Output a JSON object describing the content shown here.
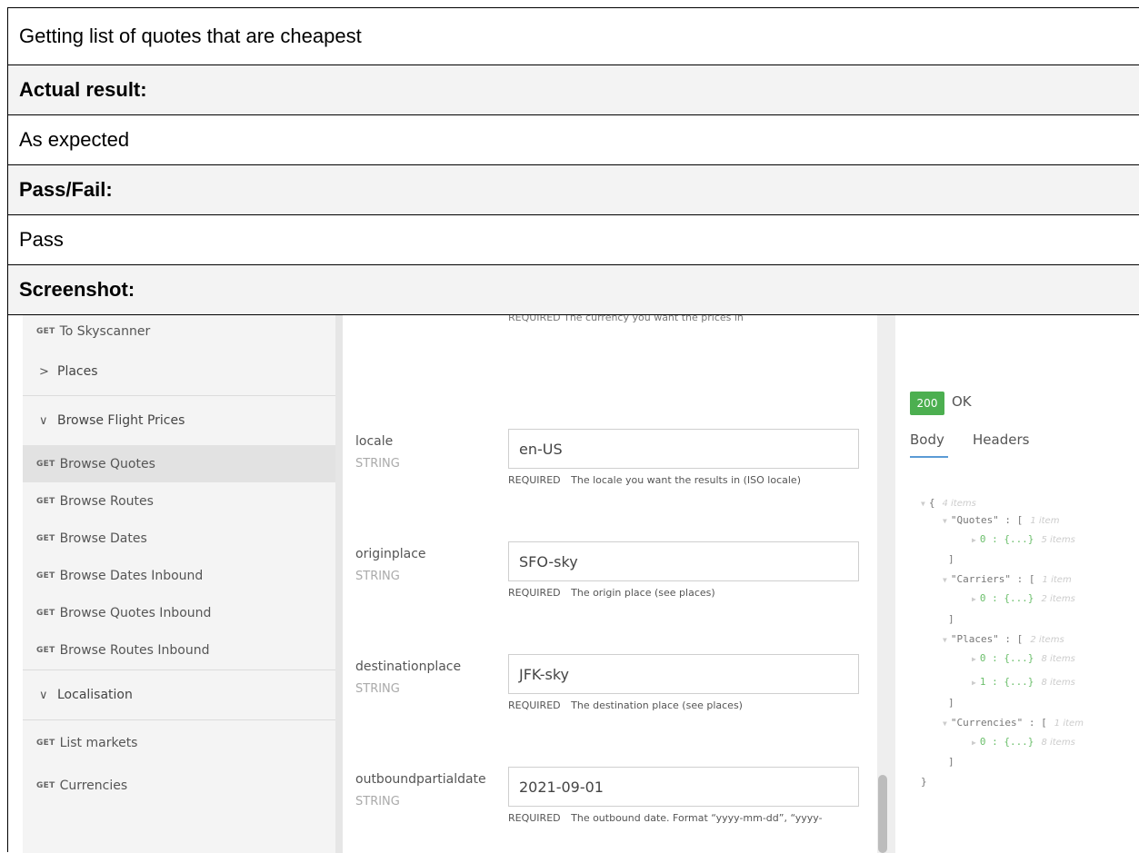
{
  "document": {
    "expected_value": "Getting list of quotes that are cheapest",
    "actual_result_label": "Actual result:",
    "actual_result_value": "As expected",
    "pass_fail_label": "Pass/Fail:",
    "pass_fail_value": "Pass",
    "screenshot_label": "Screenshot:"
  },
  "sidebar": {
    "top_item": {
      "verb": "GET",
      "label": "To Skyscanner"
    },
    "groups": [
      {
        "label": "Places",
        "expanded": false
      },
      {
        "label": "Browse Flight Prices",
        "expanded": true
      },
      {
        "label": "Localisation",
        "expanded": true
      }
    ],
    "chevrons": {
      "collapsed": ">",
      "expanded": "∨"
    },
    "browse_items": [
      {
        "verb": "GET",
        "label": "Browse Quotes",
        "selected": true
      },
      {
        "verb": "GET",
        "label": "Browse Routes"
      },
      {
        "verb": "GET",
        "label": "Browse Dates"
      },
      {
        "verb": "GET",
        "label": "Browse Dates Inbound"
      },
      {
        "verb": "GET",
        "label": "Browse Quotes Inbound"
      },
      {
        "verb": "GET",
        "label": "Browse Routes Inbound"
      }
    ],
    "localisation_items": [
      {
        "verb": "GET",
        "label": "List markets"
      },
      {
        "verb": "GET",
        "label": "Currencies"
      }
    ]
  },
  "params": {
    "cut_hint": "REQUIRED   The currency you want the prices in",
    "fields": [
      {
        "name": "locale",
        "type": "STRING",
        "value": "en-US",
        "required": "REQUIRED",
        "hint": "The locale you want the results in (ISO locale)"
      },
      {
        "name": "originplace",
        "type": "STRING",
        "value": "SFO-sky",
        "required": "REQUIRED",
        "hint": "The origin place (see places)"
      },
      {
        "name": "destinationplace",
        "type": "STRING",
        "value": "JFK-sky",
        "required": "REQUIRED",
        "hint": "The destination place (see places)"
      },
      {
        "name": "outboundpartialdate",
        "type": "STRING",
        "value": "2021-09-01",
        "required": "REQUIRED",
        "hint": "The outbound date. Format “yyyy-mm-dd”, “yyyy-"
      }
    ]
  },
  "response": {
    "status_code": "200",
    "status_text": "OK",
    "tabs": [
      "Body",
      "Headers"
    ],
    "active_tab": "Body",
    "json_lines": {
      "root_open": "{",
      "root_meta": "4 items",
      "quotes": "\"Quotes\" : [",
      "quotes_meta": "1 item",
      "quotes_0": "0 : {...}",
      "quotes_0_meta": "5 items",
      "close_1": "]",
      "carriers": "\"Carriers\" : [",
      "carriers_meta": "1 item",
      "carriers_0": "0 : {...}",
      "carriers_0_meta": "2 items",
      "close_2": "]",
      "places": "\"Places\" : [",
      "places_meta": "2 items",
      "places_0": "0 : {...}",
      "places_0_meta": "8 items",
      "places_1": "1 : {...}",
      "places_1_meta": "8 items",
      "close_3": "]",
      "currencies": "\"Currencies\" : [",
      "currencies_meta": "1 item",
      "currencies_0": "0 : {...}",
      "currencies_0_meta": "8 items",
      "close_4": "]",
      "root_close": "}"
    }
  },
  "colors": {
    "status_ok": "#4caf50",
    "header_bg": "#f3f3f3",
    "selected_item": "#e2e2e2",
    "tab_underline": "#5b9bd5"
  }
}
